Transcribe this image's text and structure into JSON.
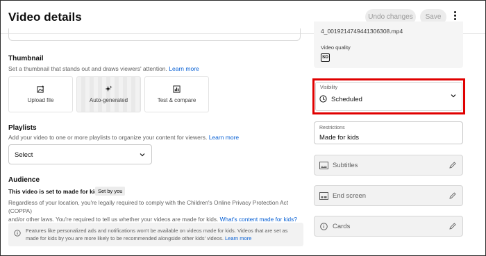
{
  "header": {
    "title": "Video details",
    "undo_label": "Undo changes",
    "save_label": "Save"
  },
  "thumbnail": {
    "heading": "Thumbnail",
    "subtitle": "Set a thumbnail that stands out and draws viewers' attention.",
    "learn_more": "Learn more",
    "options": [
      {
        "label": "Upload file",
        "icon": "add-photo-icon"
      },
      {
        "label": "Auto-generated",
        "icon": "sparkle-icon"
      },
      {
        "label": "Test & compare",
        "icon": "bar-chart-icon"
      }
    ]
  },
  "playlists": {
    "heading": "Playlists",
    "subtitle": "Add your video to one or more playlists to organize your content for viewers.",
    "learn_more": "Learn more",
    "select_value": "Select"
  },
  "audience": {
    "heading": "Audience",
    "status": "This video is set to made for kids",
    "badge": "Set by you",
    "para_line1": "Regardless of your location, you're legally required to comply with the Children's Online Privacy Protection Act (COPPA)",
    "para_line2": "and/or other laws. You're required to tell us whether your videos are made for kids.",
    "para_link": "What's content made for kids?",
    "info_text": "Features like personalized ads and notifications won't be available on videos made for kids. Videos that are set as made for kids by you are more likely to be recommended alongside other kids' videos.",
    "info_link": "Learn more"
  },
  "video_info": {
    "filename": "4_0019214749441306308.mp4",
    "quality_label": "Video quality",
    "quality_badge": "SD"
  },
  "visibility": {
    "label": "Visibility",
    "value": "Scheduled"
  },
  "restrictions": {
    "label": "Restrictions",
    "value": "Made for kids"
  },
  "features": [
    {
      "label": "Subtitles",
      "icon": "subtitles-icon"
    },
    {
      "label": "End screen",
      "icon": "end-screen-icon"
    },
    {
      "label": "Cards",
      "icon": "info-icon"
    }
  ],
  "colors": {
    "link": "#065fd4",
    "highlight": "#e00000"
  }
}
